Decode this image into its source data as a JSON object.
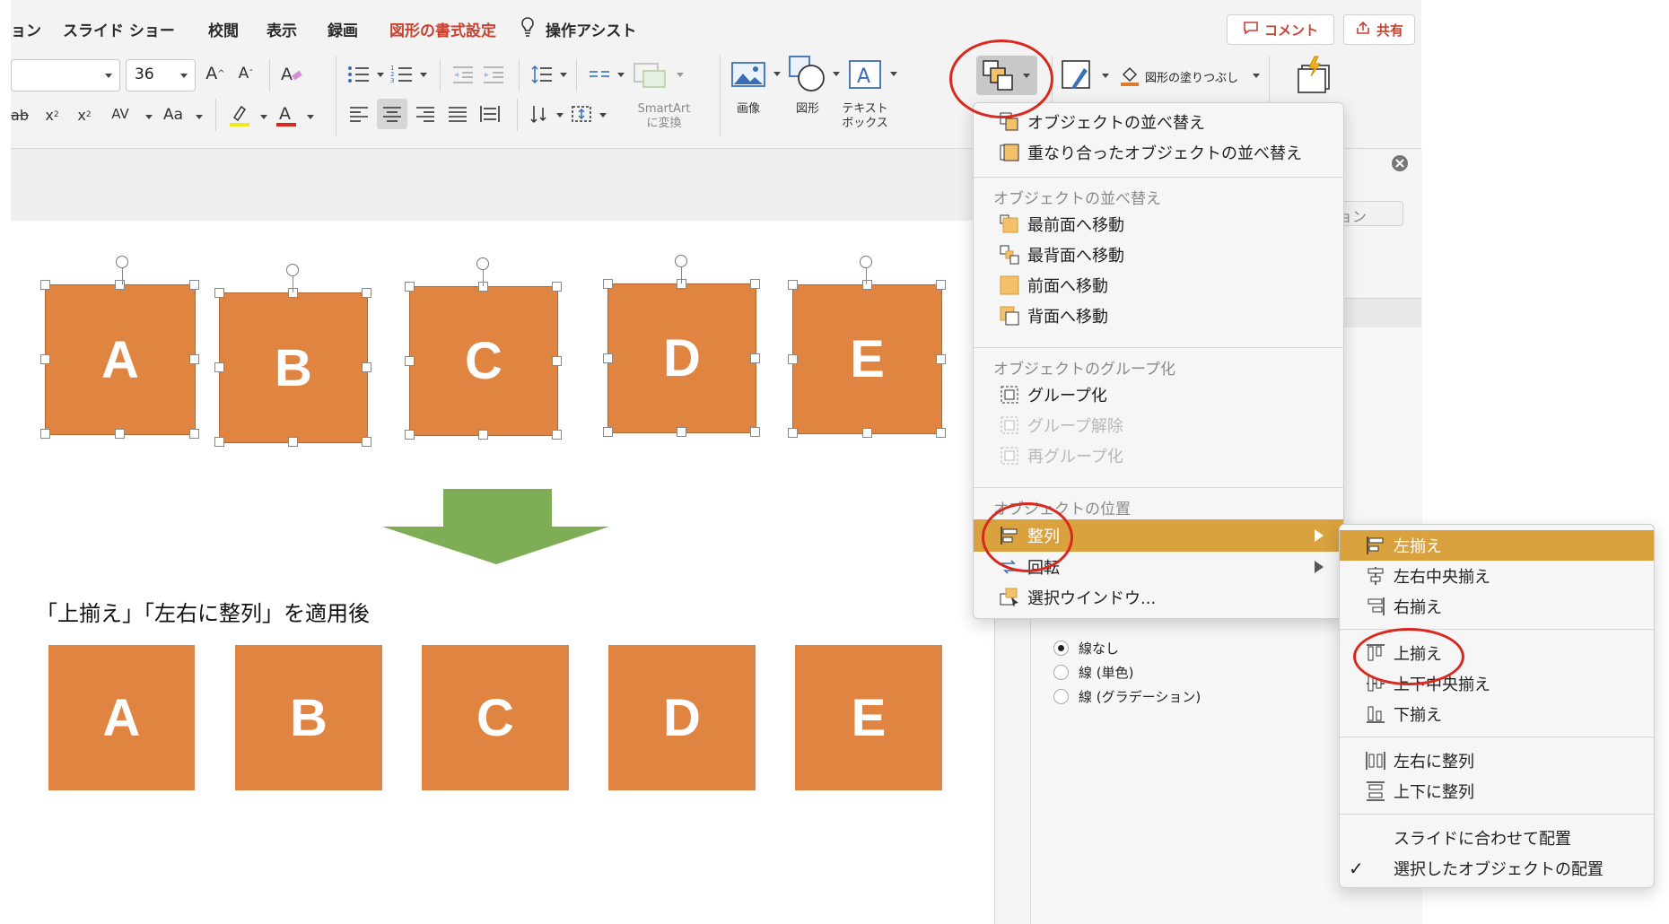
{
  "ribbon": {
    "tabs": [
      "ョン",
      "スライド ショー",
      "校閲",
      "表示",
      "録画",
      "図形の書式設定",
      "操作アシスト"
    ],
    "font_size": "36",
    "comment_label": "コメント",
    "share_label": "共有",
    "smartart_label": "SmartArt",
    "smartart_sub": "に変換",
    "image_label": "画像",
    "shape_label": "図形",
    "textbox_label": "テキスト",
    "textbox_sub": "ボックス",
    "fill_label": "図形の塗りつぶし"
  },
  "slide": {
    "top_shapes": [
      "A",
      "B",
      "C",
      "D",
      "E"
    ],
    "caption": "「上揃え」「左右に整列」を適用後",
    "bottom_shapes": [
      "A",
      "B",
      "C",
      "D",
      "E"
    ]
  },
  "right_pane": {
    "partial_label": "ョン",
    "line_options": [
      "線なし",
      "線 (単色)",
      "線 (グラデーション)"
    ]
  },
  "arrange_menu": {
    "top_items": [
      "オブジェクトの並べ替え",
      "重なり合ったオブジェクトの並べ替え"
    ],
    "order_header": "オブジェクトの並べ替え",
    "order_items": [
      "最前面へ移動",
      "最背面へ移動",
      "前面へ移動",
      "背面へ移動"
    ],
    "group_header": "オブジェクトのグループ化",
    "group_items": [
      "グループ化",
      "グループ解除",
      "再グループ化"
    ],
    "position_header": "オブジェクトの位置",
    "position_items": [
      "整列",
      "回転",
      "選択ウインドウ..."
    ]
  },
  "align_submenu": {
    "horizontal": [
      "左揃え",
      "左右中央揃え",
      "右揃え"
    ],
    "vertical": [
      "上揃え",
      "上下中央揃え",
      "下揃え"
    ],
    "distribute": [
      "左右に整列",
      "上下に整列"
    ],
    "relative": [
      "スライドに合わせて配置",
      "選択したオブジェクトの配置"
    ],
    "checkmark": "✓"
  },
  "colors": {
    "shape_fill": "#df8441",
    "highlight": "#d9a23f",
    "annotation": "#d9281e",
    "arrow": "#7fad55",
    "active_tab": "#c9412f"
  }
}
